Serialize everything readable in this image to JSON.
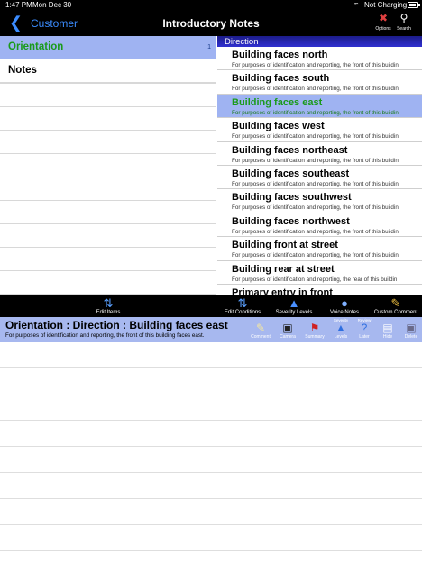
{
  "status": {
    "time": "1:47 PM",
    "date": "Mon Dec 30",
    "charging": "Not Charging",
    "battery_level": 0.9
  },
  "nav": {
    "back_label": "Customer",
    "title": "Introductory Notes",
    "options_label": "Options",
    "search_label": "Search"
  },
  "categories": [
    {
      "label": "Orientation",
      "count": "1",
      "selected": true
    },
    {
      "label": "Notes",
      "count": "",
      "selected": false
    }
  ],
  "conditions": {
    "header": "Direction",
    "items": [
      {
        "title": "Building faces north",
        "subtitle": "For purposes of identification and reporting, the front of this buildin",
        "selected": false
      },
      {
        "title": "Building faces south",
        "subtitle": "For purposes of identification and reporting, the front of this buildin",
        "selected": false
      },
      {
        "title": "Building faces east",
        "subtitle": "For purposes of identification and reporting, the front of this buildin",
        "selected": true
      },
      {
        "title": "Building faces west",
        "subtitle": "For purposes of identification and reporting, the front of this buildin",
        "selected": false
      },
      {
        "title": "Building faces northeast",
        "subtitle": "For purposes of identification and reporting, the front of this buildin",
        "selected": false
      },
      {
        "title": "Building faces southeast",
        "subtitle": "For purposes of identification and reporting, the front of this buildin",
        "selected": false
      },
      {
        "title": "Building faces southwest",
        "subtitle": "For purposes of identification and reporting, the front of this buildin",
        "selected": false
      },
      {
        "title": "Building faces northwest",
        "subtitle": "For purposes of identification and reporting, the front of this buildin",
        "selected": false
      },
      {
        "title": "Building front at street",
        "subtitle": "For purposes of identification and reporting, the front of this buildin",
        "selected": false
      },
      {
        "title": "Building rear at street",
        "subtitle": "For purposes of identification and reporting, the rear of this buildin",
        "selected": false
      },
      {
        "title": "Primary entry in front",
        "subtitle": "",
        "selected": false
      }
    ]
  },
  "toolbar": {
    "edit_items": "Edit Items",
    "edit_conditions": "Edit Conditions",
    "severity_levels": "Severity Levels",
    "voice_notes": "Voice Notes",
    "custom_comment": "Custom Comment"
  },
  "detail": {
    "title": "Orientation : Direction : Building faces east",
    "subtitle": "For purposes of identification and reporting, the front of this building faces east.",
    "buttons": {
      "comment": "Comment",
      "camera": "Camera",
      "summary": "Summary",
      "levels_top": "Severity",
      "levels": "Levels",
      "later_top": "Review",
      "later": "Later",
      "hide": "Hide",
      "delete": "Delete"
    }
  },
  "colors": {
    "accent_blue": "#3b8cff",
    "selected_bg": "#9fb3f2",
    "selected_text": "#1a9a1a",
    "header_blue": "#2a2ab8"
  }
}
